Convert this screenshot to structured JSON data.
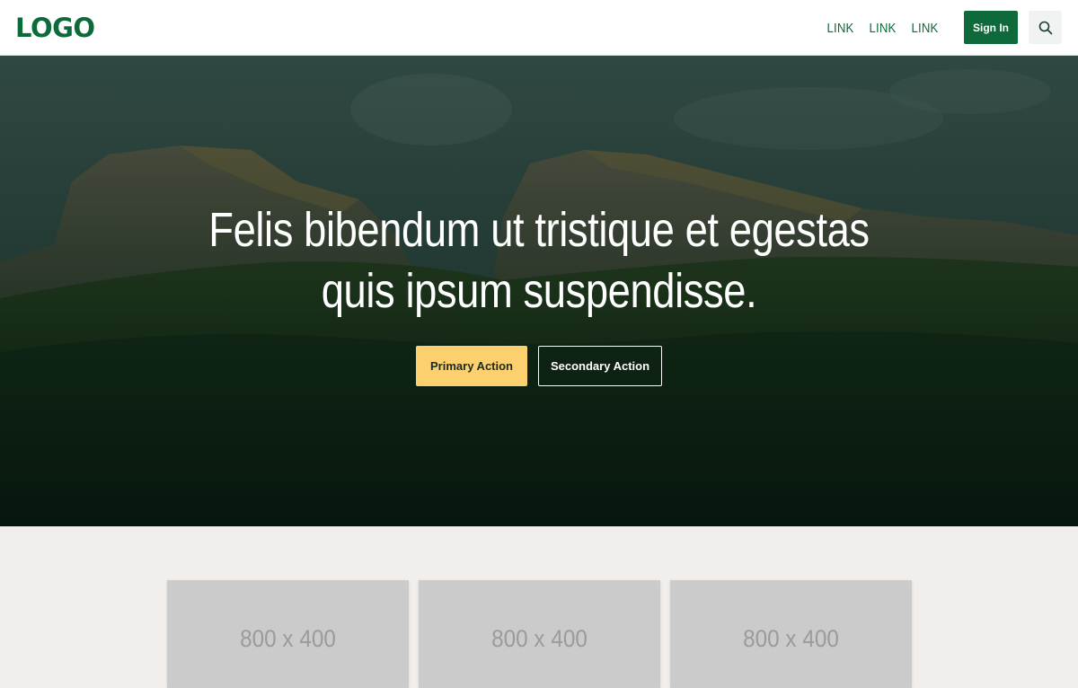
{
  "header": {
    "logo": "LOGO",
    "links": [
      "LINK",
      "LINK",
      "LINK"
    ],
    "signin_label": "Sign In",
    "search_icon": "search-icon"
  },
  "hero": {
    "title": "Felis bibendum ut tristique et egestas quis ipsum suspendisse.",
    "primary_action": "Primary Action",
    "secondary_action": "Secondary Action"
  },
  "cards": [
    {
      "placeholder": "800 x 400"
    },
    {
      "placeholder": "800 x 400"
    },
    {
      "placeholder": "800 x 400"
    }
  ],
  "colors": {
    "brand_green": "#0e6a3a",
    "accent_yellow": "#fcd06e",
    "page_background": "#f2eeeb",
    "placeholder_gray": "#cbcbcb"
  }
}
